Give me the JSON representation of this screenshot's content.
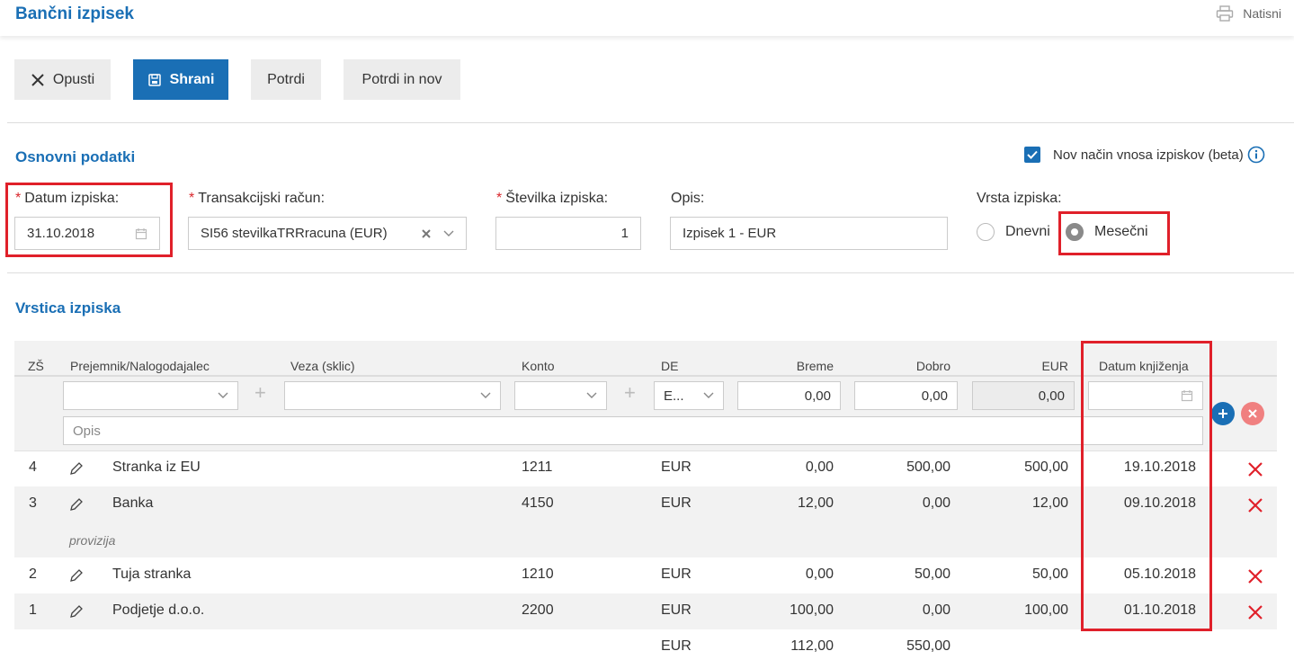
{
  "header": {
    "title": "Bančni izpisek",
    "print_label": "Natisni"
  },
  "toolbar": {
    "cancel": "Opusti",
    "save": "Shrani",
    "confirm": "Potrdi",
    "confirm_new": "Potrdi in nov"
  },
  "basic": {
    "title": "Osnovni podatki",
    "beta_label": "Nov način vnosa izpiskov (beta)",
    "beta_checked": true,
    "date_label": "Datum izpiska:",
    "date_value": "31.10.2018",
    "account_label": "Transakcijski račun:",
    "account_value": "SI56 stevilkaTRRracuna (EUR)",
    "number_label": "Številka izpiska:",
    "number_value": "1",
    "desc_label": "Opis:",
    "desc_value": "Izpisek 1 - EUR",
    "type_label": "Vrsta izpiska:",
    "type_options": [
      "Dnevni",
      "Mesečni"
    ],
    "type_selected": "Mesečni"
  },
  "lines": {
    "title": "Vrstica izpiska",
    "columns": [
      "ZŠ",
      "Prejemnik/Nalogodajalec",
      "Veza (sklic)",
      "Konto",
      "DE",
      "Breme",
      "Dobro",
      "EUR",
      "Datum knjiženja"
    ],
    "edit": {
      "currency": "E...",
      "breme": "0,00",
      "dobro": "0,00",
      "eur": "0,00",
      "opis_placeholder": "Opis"
    },
    "rows": [
      {
        "zs": "4",
        "partner": "Stranka iz EU",
        "konto": "1211",
        "de": "EUR",
        "breme": "0,00",
        "dobro": "500,00",
        "eur": "500,00",
        "date": "19.10.2018",
        "note": ""
      },
      {
        "zs": "3",
        "partner": "Banka",
        "konto": "4150",
        "de": "EUR",
        "breme": "12,00",
        "dobro": "0,00",
        "eur": "12,00",
        "date": "09.10.2018",
        "note": "provizija"
      },
      {
        "zs": "2",
        "partner": "Tuja stranka",
        "konto": "1210",
        "de": "EUR",
        "breme": "0,00",
        "dobro": "50,00",
        "eur": "50,00",
        "date": "05.10.2018",
        "note": ""
      },
      {
        "zs": "1",
        "partner": "Podjetje d.o.o.",
        "konto": "2200",
        "de": "EUR",
        "breme": "100,00",
        "dobro": "0,00",
        "eur": "100,00",
        "date": "01.10.2018",
        "note": ""
      }
    ],
    "totals": {
      "de": "EUR",
      "breme": "112,00",
      "dobro": "550,00"
    }
  },
  "colors": {
    "accent": "#1a6fb5",
    "highlight": "#e0202a",
    "delete": "#e0202a",
    "add": "#1a6fb5",
    "remove": "#f08080"
  }
}
